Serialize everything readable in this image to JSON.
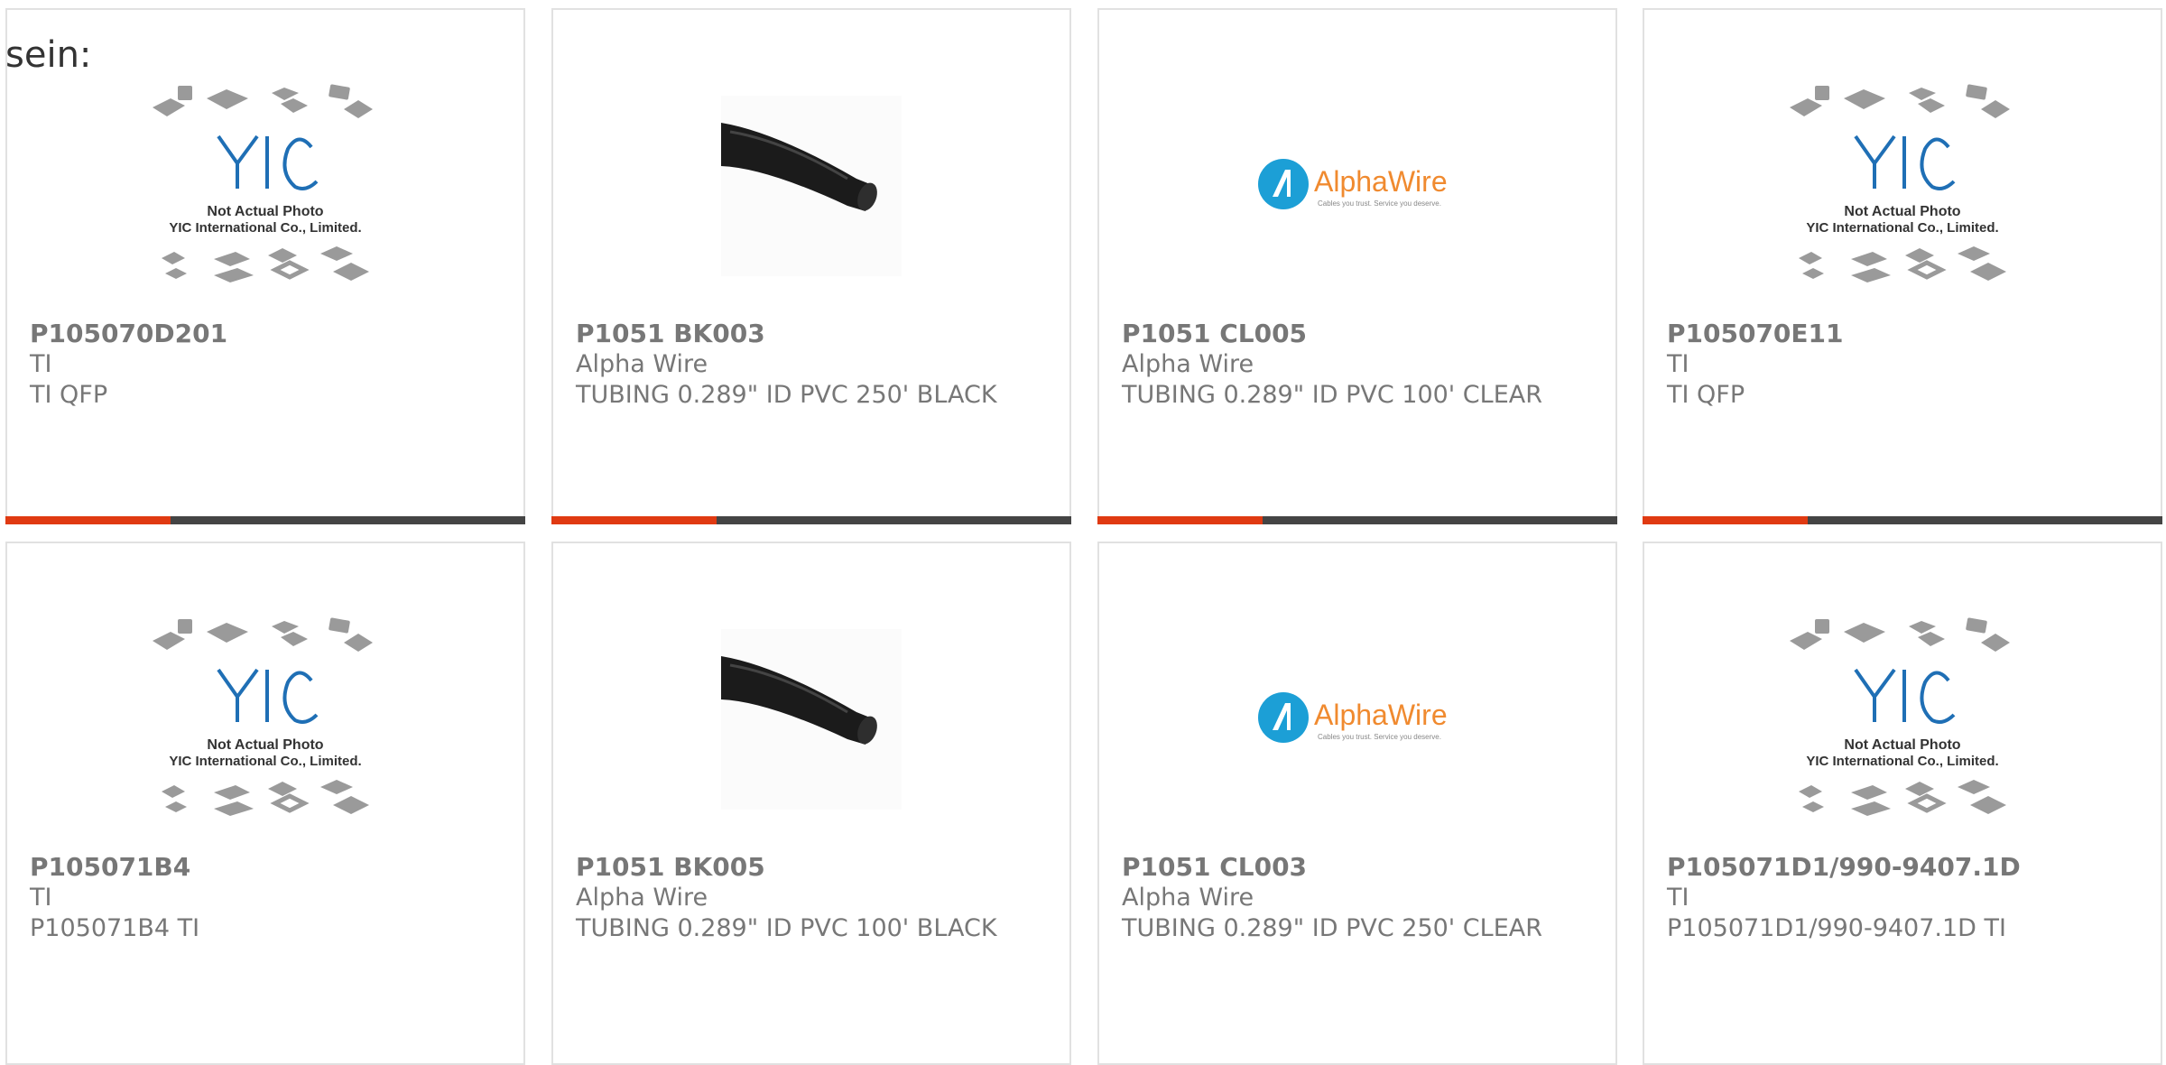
{
  "intro_text": "sein:",
  "placeholder": {
    "brand": "YIC",
    "line1": "Not Actual Photo",
    "line2": "YIC International Co., Limited."
  },
  "logo": {
    "brand": "AlphaWire",
    "tagline": "Cables you trust. Service you deserve."
  },
  "colors": {
    "accent": "#e03a12",
    "bar": "#444444",
    "yic_blue": "#1f6fb5",
    "alpha_blue": "#1c9fd6",
    "alpha_orange": "#f08a2f"
  },
  "products": [
    {
      "part": "P105070D201",
      "maker": "TI",
      "desc": "TI QFP",
      "image": "yic-placeholder"
    },
    {
      "part": "P1051 BK003",
      "maker": "Alpha Wire",
      "desc": "TUBING 0.289\" ID PVC 250' BLACK",
      "image": "black-tubing"
    },
    {
      "part": "P1051 CL005",
      "maker": "Alpha Wire",
      "desc": "TUBING 0.289\" ID PVC 100' CLEAR",
      "image": "alphawire-logo"
    },
    {
      "part": "P105070E11",
      "maker": "TI",
      "desc": "TI QFP",
      "image": "yic-placeholder"
    },
    {
      "part": "P105071B4",
      "maker": "TI",
      "desc": "P105071B4 TI",
      "image": "yic-placeholder"
    },
    {
      "part": "P1051 BK005",
      "maker": "Alpha Wire",
      "desc": "TUBING 0.289\" ID PVC 100' BLACK",
      "image": "black-tubing"
    },
    {
      "part": "P1051 CL003",
      "maker": "Alpha Wire",
      "desc": "TUBING 0.289\" ID PVC 250' CLEAR",
      "image": "alphawire-logo"
    },
    {
      "part": "P105071D1/990-9407.1D",
      "maker": "TI",
      "desc": "P105071D1/990-9407.1D TI",
      "image": "yic-placeholder"
    }
  ]
}
